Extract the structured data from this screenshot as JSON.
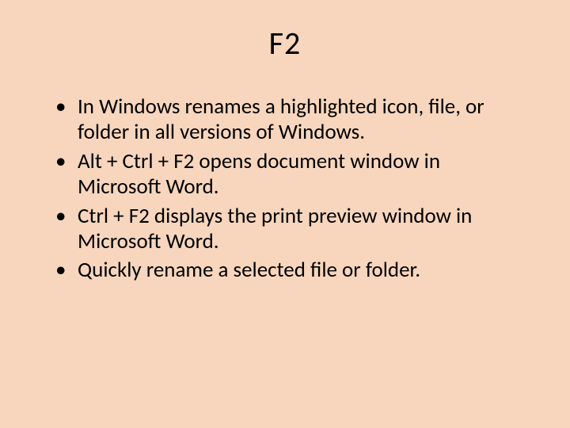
{
  "title": "F2",
  "bullets": [
    "In Windows renames a highlighted icon, file, or folder in all versions of Windows.",
    "Alt + Ctrl + F2 opens document window in Microsoft Word.",
    "Ctrl + F2 displays the print preview window in Microsoft Word.",
    "Quickly rename a selected file or folder."
  ]
}
